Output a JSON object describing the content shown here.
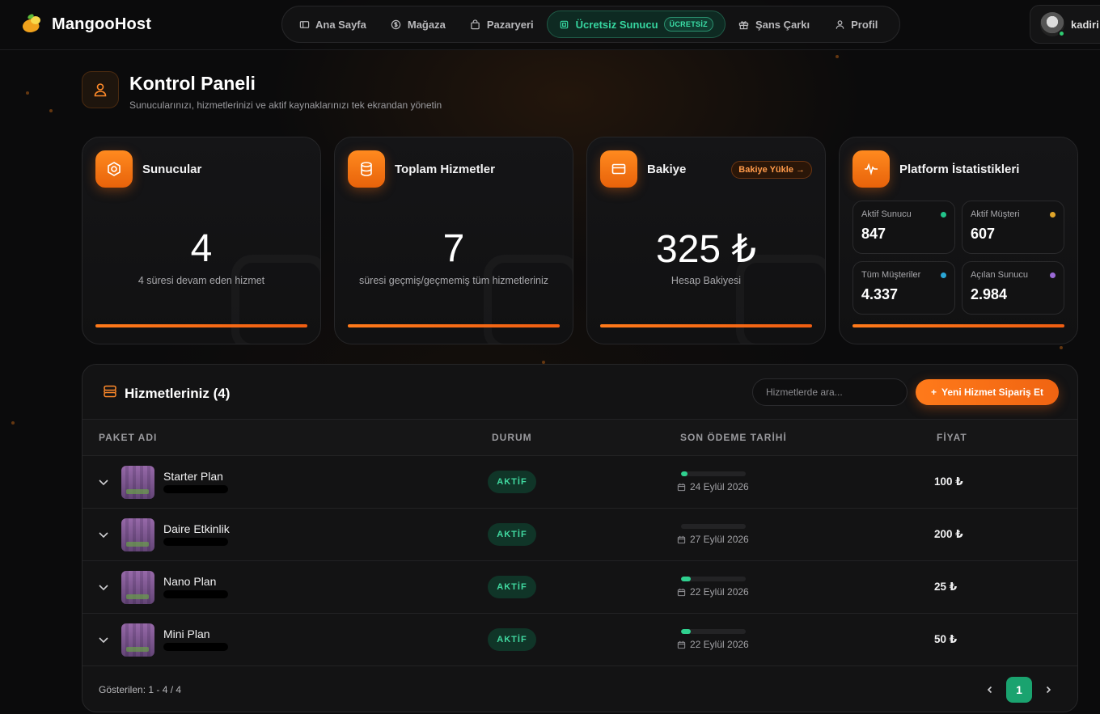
{
  "brand": {
    "name": "MangooHost"
  },
  "nav": {
    "items": [
      {
        "label": "Ana Sayfa",
        "icon": "home-icon"
      },
      {
        "label": "Mağaza",
        "icon": "dollar-icon"
      },
      {
        "label": "Pazaryeri",
        "icon": "bag-icon"
      },
      {
        "label": "Ücretsiz Sunucu",
        "icon": "chip-icon",
        "badge": "ÜCRETSİZ",
        "active": true
      },
      {
        "label": "Şans Çarkı",
        "icon": "gift-icon"
      },
      {
        "label": "Profil",
        "icon": "user-icon"
      }
    ]
  },
  "user": {
    "name": "kadiri"
  },
  "page": {
    "title": "Kontrol Paneli",
    "subtitle": "Sunucularınızı, hizmetlerinizi ve aktif kaynaklarınızı tek ekrandan yönetin"
  },
  "cards": {
    "servers": {
      "title": "Sunucular",
      "value": "4",
      "caption": "4 süresi devam eden hizmet"
    },
    "services": {
      "title": "Toplam Hizmetler",
      "value": "7",
      "caption": "süresi geçmiş/geçmemiş tüm hizmetleriniz"
    },
    "balance": {
      "title": "Bakiye",
      "value": "325 ₺",
      "caption": "Hesap Bakiyesi",
      "topup_label": "Bakiye Yükle →"
    },
    "platform": {
      "title": "Platform İstatistikleri",
      "stats": [
        {
          "label": "Aktif Sunucu",
          "value": "847",
          "color": "#22c48a"
        },
        {
          "label": "Aktif Müşteri",
          "value": "607",
          "color": "#e0a52a"
        },
        {
          "label": "Tüm Müşteriler",
          "value": "4.337",
          "color": "#2aa6d6"
        },
        {
          "label": "Açılan Sunucu",
          "value": "2.984",
          "color": "#9b6ad6"
        }
      ]
    }
  },
  "services_panel": {
    "title": "Hizmetleriniz (4)",
    "search_placeholder": "Hizmetlerde ara...",
    "new_button": "Yeni Hizmet Sipariş Et",
    "columns": [
      "PAKET ADI",
      "DURUM",
      "SON ÖDEME TARİHİ",
      "FİYAT"
    ],
    "rows": [
      {
        "name": "Starter Plan",
        "status": "AKTİF",
        "progress": 0.1,
        "date": "24 Eylül 2026",
        "price": "100 ₺"
      },
      {
        "name": "Daire Etkinlik",
        "status": "AKTİF",
        "progress": 0.0,
        "date": "27 Eylül 2026",
        "price": "200 ₺"
      },
      {
        "name": "Nano Plan",
        "status": "AKTİF",
        "progress": 0.15,
        "date": "22 Eylül 2026",
        "price": "25 ₺"
      },
      {
        "name": "Mini Plan",
        "status": "AKTİF",
        "progress": 0.15,
        "date": "22 Eylül 2026",
        "price": "50 ₺"
      }
    ],
    "footer": "Gösterilen: 1 - 4 / 4",
    "current_page": "1"
  }
}
